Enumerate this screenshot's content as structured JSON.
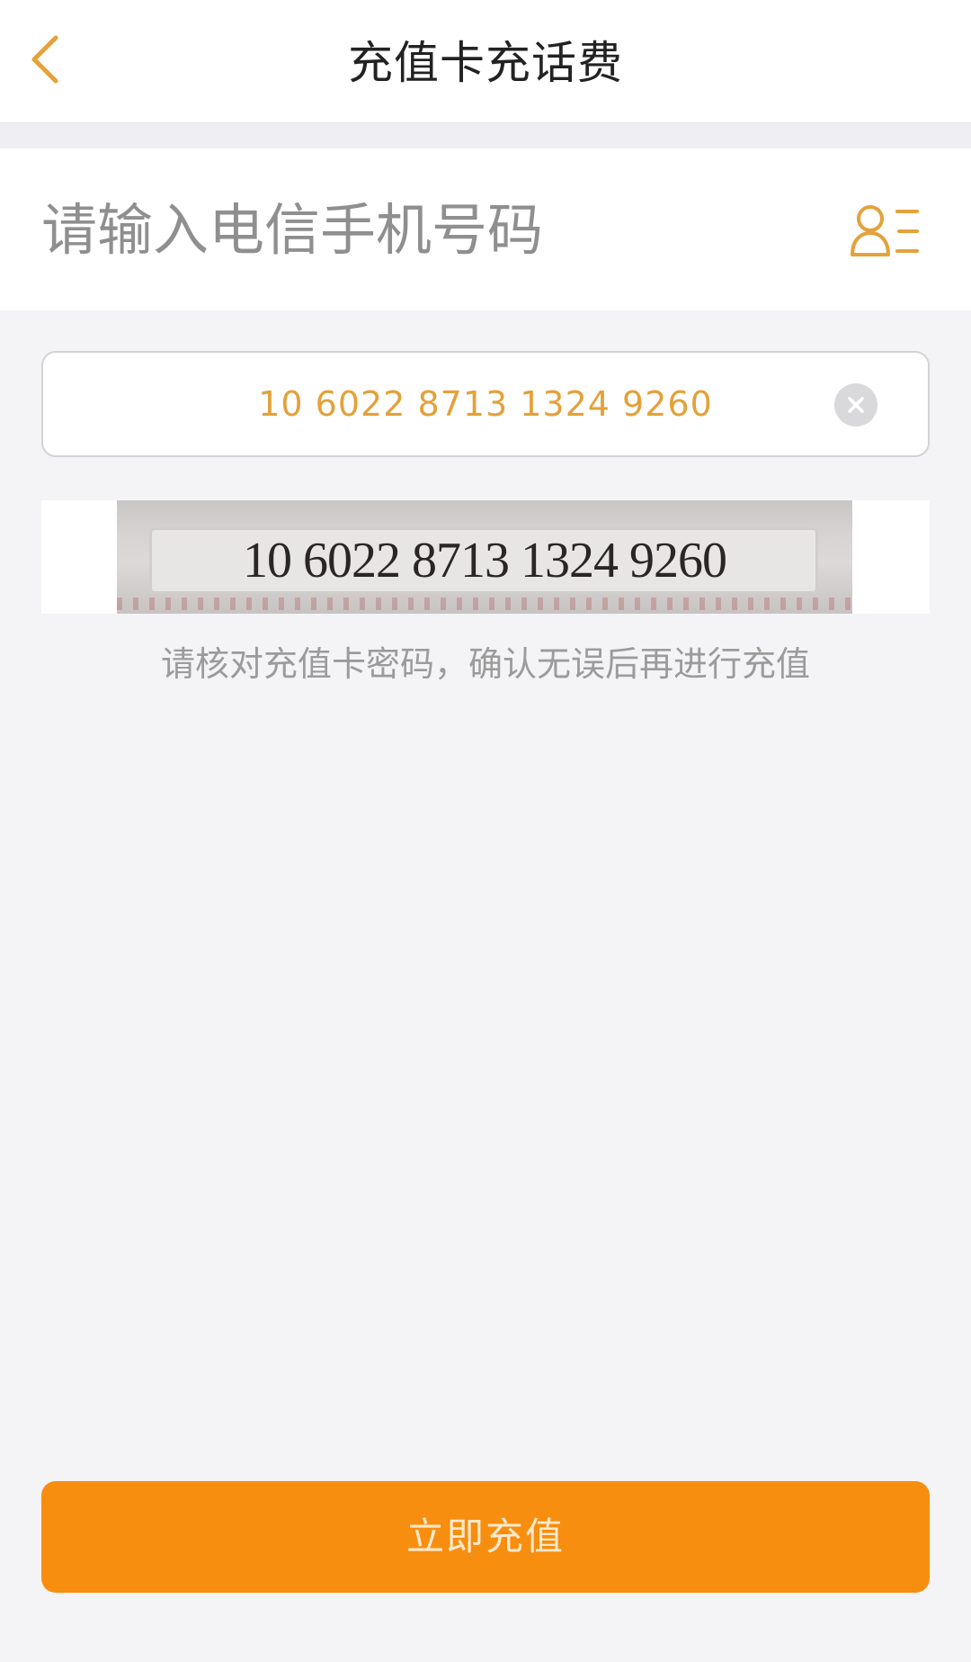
{
  "header": {
    "title": "充值卡充话费",
    "back_icon": "chevron-left-icon"
  },
  "phone": {
    "placeholder": "请输入电信手机号码",
    "value": "",
    "contacts_icon": "contacts-icon"
  },
  "card_password": {
    "value": "10 6022 8713 1324 9260",
    "clear_icon": "clear-icon"
  },
  "scan_preview": {
    "text": "10 6022 8713 1324 9260"
  },
  "hint": "请核对充值卡密码，确认无误后再进行充值",
  "submit": {
    "label": "立即充值"
  },
  "colors": {
    "accent": "#F78E0F",
    "card_text": "#E4A13A",
    "icon": "#E3A23B"
  }
}
